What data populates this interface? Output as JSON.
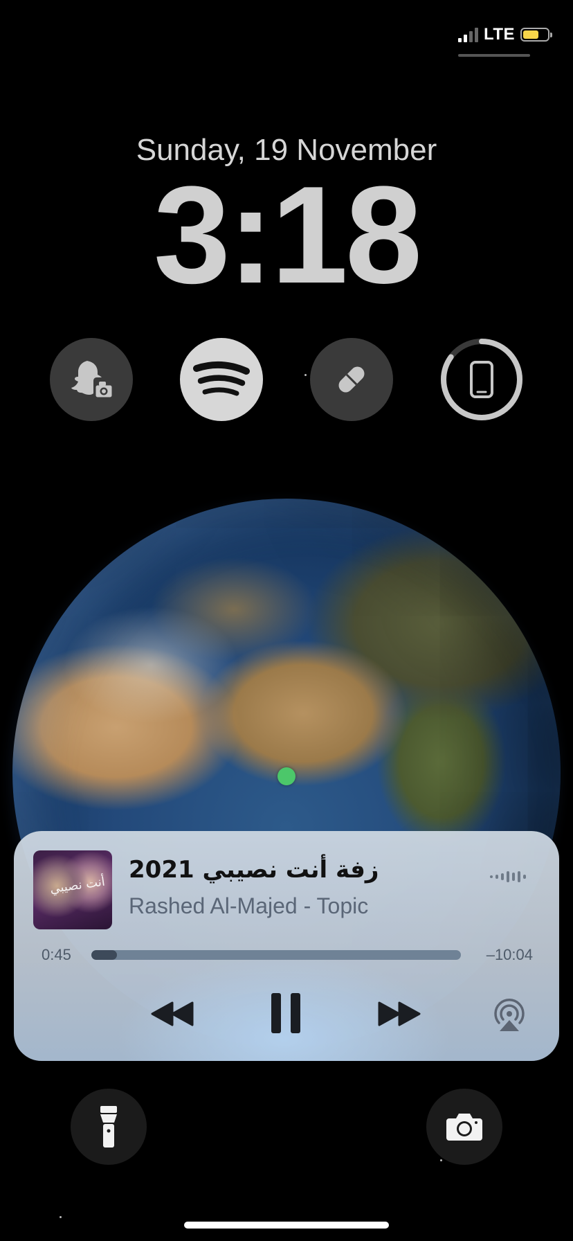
{
  "status_bar": {
    "network": "LTE",
    "battery_level": 0.65,
    "colors": {
      "battery": "#f6d54a"
    }
  },
  "lock_screen": {
    "date": "Sunday, 19 November",
    "time": "3:18"
  },
  "widgets": [
    {
      "name": "snapchat-camera",
      "icon": "snapchat-camera-icon"
    },
    {
      "name": "spotify",
      "icon": "spotify-icon"
    },
    {
      "name": "medications",
      "icon": "pill-icon"
    },
    {
      "name": "device-battery",
      "icon": "phone-icon",
      "level": 0.85
    }
  ],
  "now_playing": {
    "title": "زفة أنت نصيبي 2021",
    "artist": "Rashed Al-Majed - Topic",
    "elapsed": "0:45",
    "remaining": "–10:04",
    "progress": 0.07,
    "album_art_text": "أنت نصيبي"
  },
  "quick_actions": {
    "left": "flashlight-icon",
    "right": "camera-icon"
  }
}
